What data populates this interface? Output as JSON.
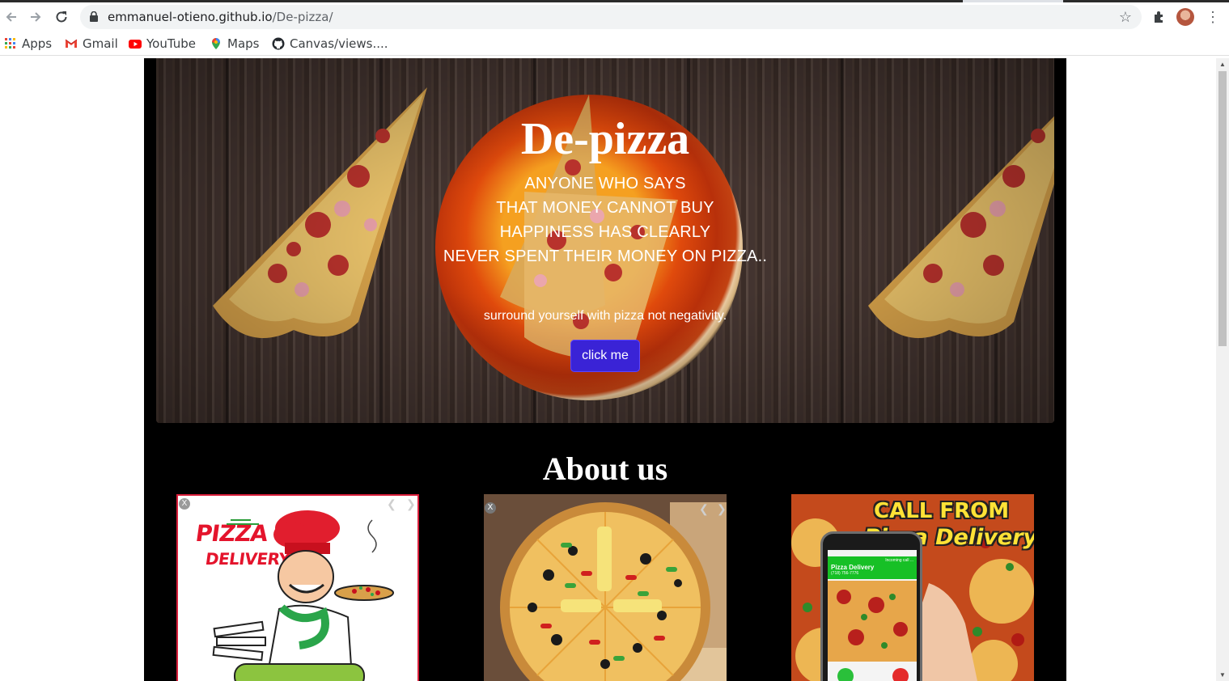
{
  "browser": {
    "url_host": "emmanuel-otieno.github.io",
    "url_path": "/De-pizza/",
    "bookmarks": [
      {
        "label": "Apps",
        "icon": "apps-grid-icon"
      },
      {
        "label": "Gmail",
        "icon": "gmail-icon"
      },
      {
        "label": "YouTube",
        "icon": "youtube-icon"
      },
      {
        "label": "Maps",
        "icon": "maps-icon"
      },
      {
        "label": "Canvas/views....",
        "icon": "github-icon"
      }
    ]
  },
  "hero": {
    "title": "De-pizza",
    "quote_lines": [
      "ANYONE WHO SAYS",
      "THAT MONEY CANNOT BUY",
      "HAPPINESS HAS CLEARLY",
      "NEVER SPENT THEIR MONEY ON PIZZA.."
    ],
    "tagline": "surround yourself with pizza not negativity.",
    "button_label": "click me"
  },
  "about": {
    "title": "About us",
    "cards": [
      {
        "title": "PIZZA",
        "subtitle": "DELIVERY",
        "close": "X"
      },
      {
        "close": "X"
      },
      {
        "title_line1": "CALL FROM",
        "title_line2": "Pizza Delivery",
        "call_name": "Pizza Delivery",
        "call_label": "Incoming call ...",
        "call_number": "(718) 756-7776"
      }
    ]
  },
  "colors": {
    "button": "#3a23d6",
    "page_background": "#000000",
    "card1_accent": "#e4142c",
    "card3_title": "#ffe236"
  }
}
